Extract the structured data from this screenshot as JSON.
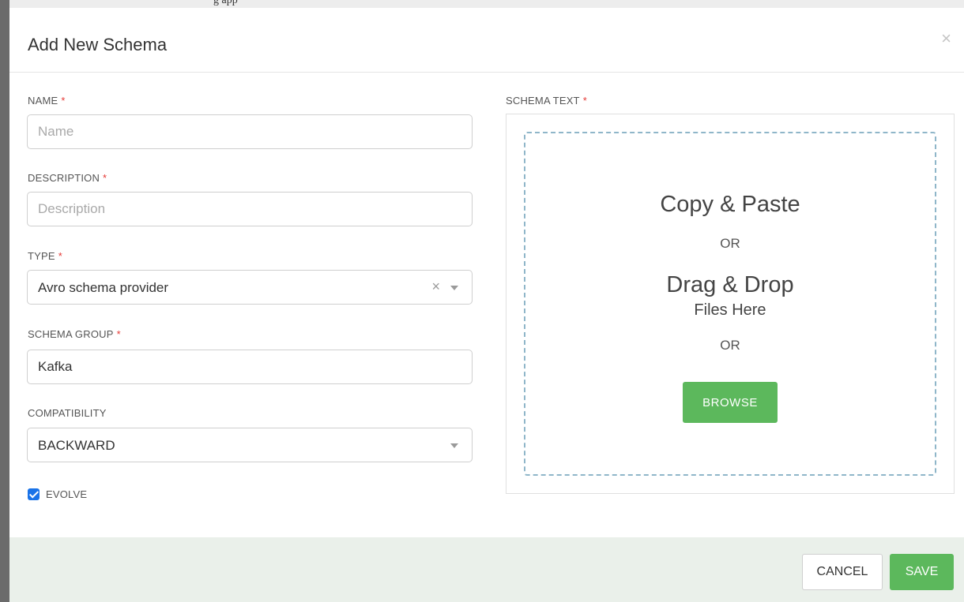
{
  "background": {
    "top_text": "g app"
  },
  "modal": {
    "title": "Add New Schema",
    "close": "×"
  },
  "form": {
    "name": {
      "label": "NAME",
      "required": "*",
      "value": "",
      "placeholder": "Name"
    },
    "description": {
      "label": "DESCRIPTION",
      "required": "*",
      "value": "",
      "placeholder": "Description"
    },
    "type": {
      "label": "TYPE",
      "required": "*",
      "selected": "Avro schema provider",
      "clear": "×"
    },
    "schema_group": {
      "label": "SCHEMA GROUP",
      "required": "*",
      "value": "Kafka",
      "placeholder": ""
    },
    "compatibility": {
      "label": "COMPATIBILITY",
      "selected": "BACKWARD"
    },
    "evolve": {
      "label": "EVOLVE",
      "checked": true
    }
  },
  "schema_text": {
    "label": "SCHEMA TEXT",
    "required": "*",
    "copy_paste": "Copy & Paste",
    "or_1": "OR",
    "drag_drop": "Drag & Drop",
    "files_here": "Files Here",
    "or_2": "OR",
    "browse_label": "BROWSE"
  },
  "footer": {
    "cancel_label": "CANCEL",
    "save_label": "SAVE"
  },
  "colors": {
    "accent_green": "#5cb85c",
    "checkbox_blue": "#1a73e8",
    "required_red": "#e53935",
    "dropzone_border": "#8fb6c9",
    "footer_bg": "#eaf0ea"
  }
}
